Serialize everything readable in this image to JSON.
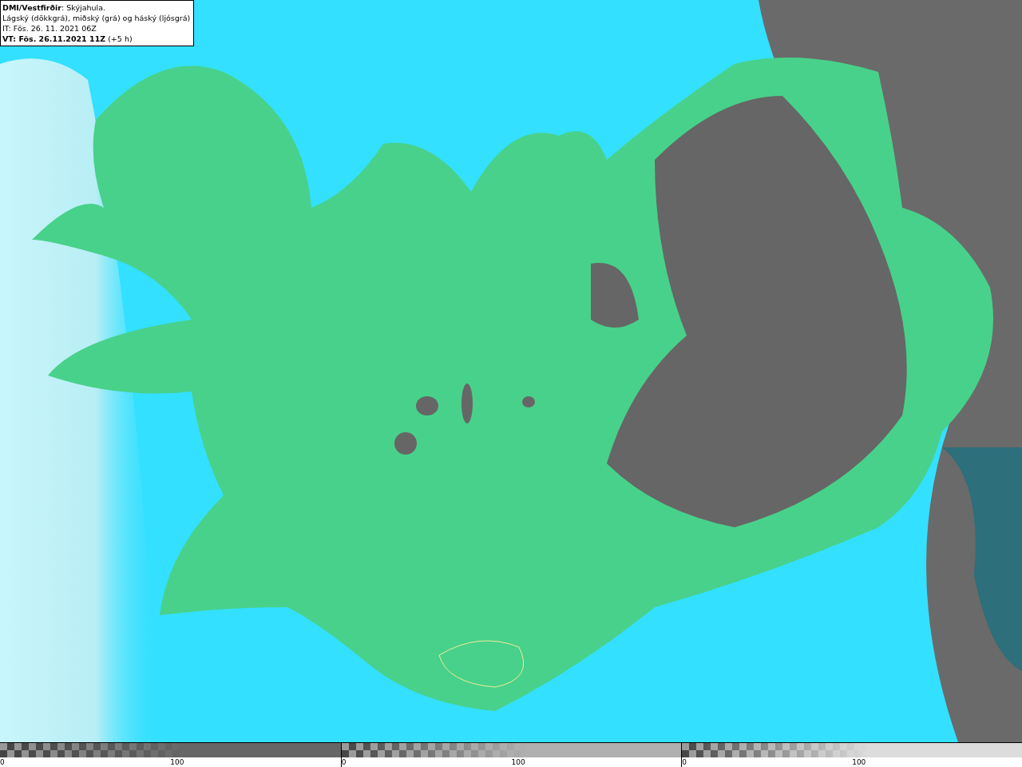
{
  "legend": {
    "lines": [
      "**DMI/Vestfirðir**: Skýjahula.",
      "Lágský (dökkgrá), miðský (grá) og háský (ljósgrá)",
      "IT: Fös. 26. 11. 2021 06Z",
      "**VT: Fös. 26.11.2021 11Z** (+5 h)"
    ]
  },
  "colorbars": [
    {
      "color": "#666666",
      "ticks": [
        "0",
        "100"
      ]
    },
    {
      "color": "#b0b0b0",
      "ticks": [
        "0",
        "100"
      ]
    },
    {
      "color": "#dcdcdc",
      "ticks": [
        "0",
        "100"
      ]
    }
  ]
}
